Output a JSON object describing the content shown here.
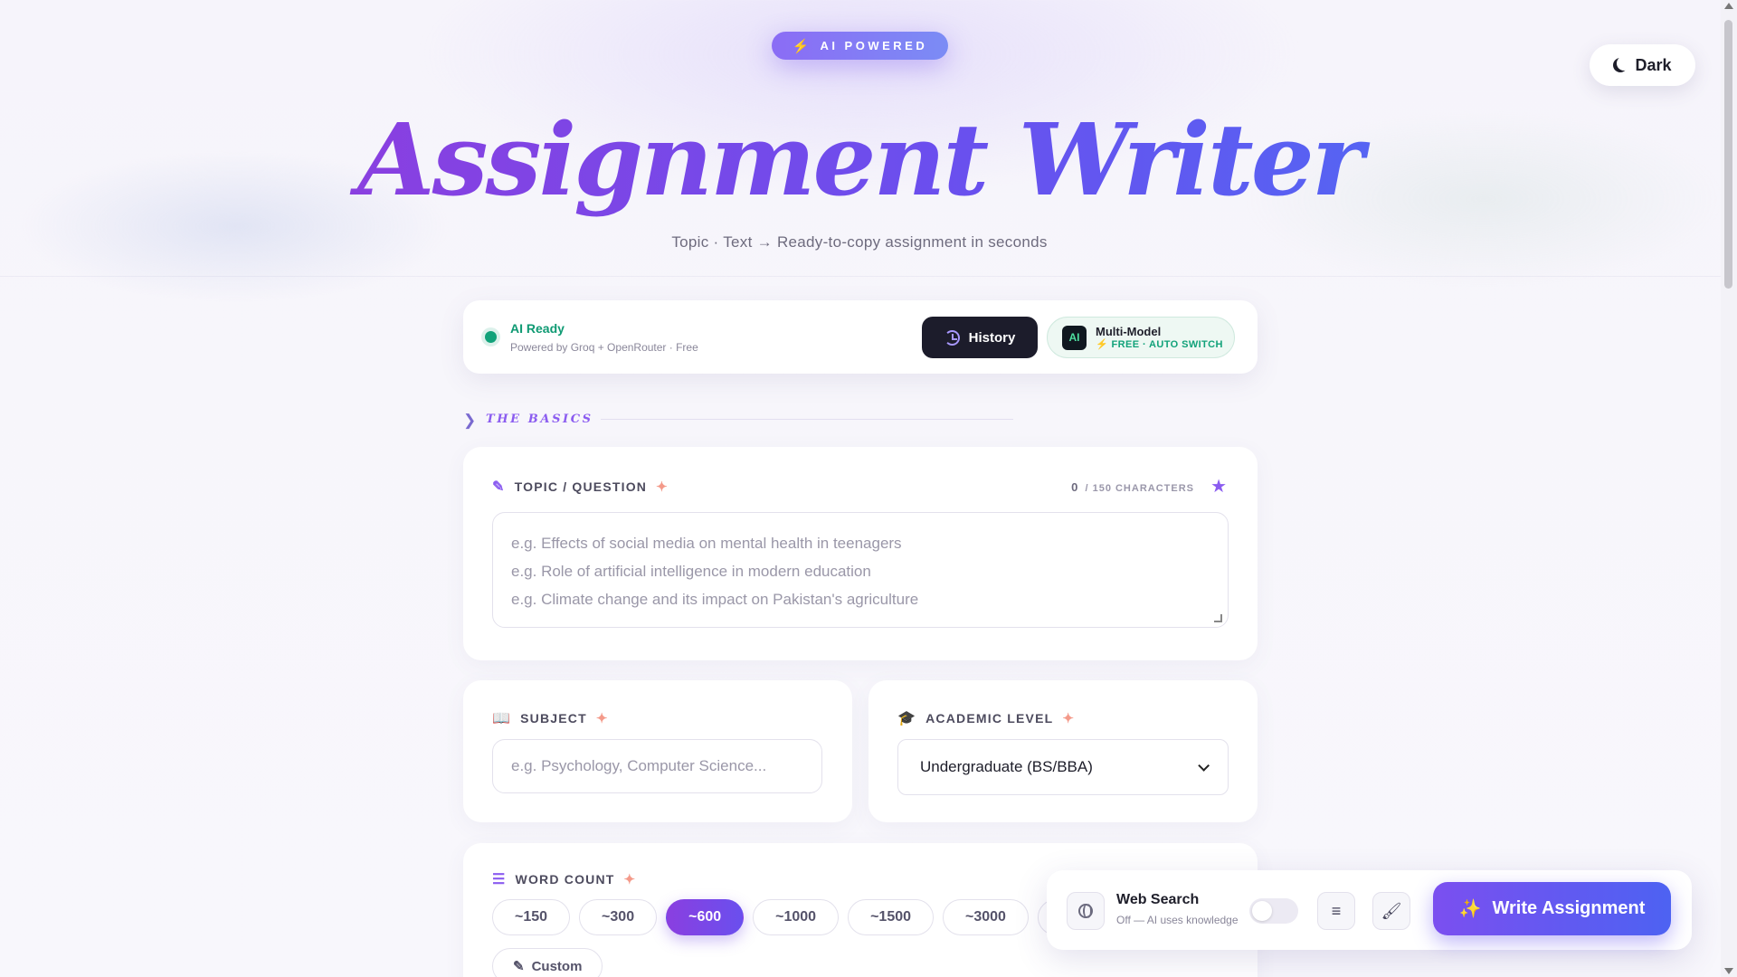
{
  "badge": {
    "icon": "bolt-icon",
    "label": "AI POWERED"
  },
  "theme_toggle": {
    "label": "Dark",
    "icon": "moon-icon"
  },
  "hero": {
    "title": "Assignment Writer",
    "subtitle": "Topic · Text → Ready-to-copy assignment in seconds"
  },
  "status": {
    "title": "AI Ready",
    "subtitle": "Powered by Groq + OpenRouter · Free",
    "history_label": "History",
    "model_badge": "AI",
    "model_title": "Multi-Model",
    "model_sub": "⚡ FREE · AUTO SWITCH"
  },
  "section": {
    "title": "THE BASICS"
  },
  "topic": {
    "label": "TOPIC / QUESTION",
    "count": "0",
    "count_suffix": "/ 150 CHARACTERS",
    "placeholder_lines": [
      "e.g. Effects of social media on mental health in teenagers",
      "e.g. Role of artificial intelligence in modern education",
      "e.g. Climate change and its impact on Pakistan's agriculture"
    ]
  },
  "subject": {
    "label": "SUBJECT",
    "placeholder": "e.g. Psychology, Computer Science..."
  },
  "level": {
    "label": "ACADEMIC LEVEL",
    "selected": "Undergraduate (BS/BBA)"
  },
  "word_count": {
    "label": "WORD COUNT",
    "options": [
      "~150",
      "~300",
      "~600",
      "~1000",
      "~1500",
      "~3000",
      "~"
    ],
    "selected": "~600",
    "custom_label": "Custom"
  },
  "action_bar": {
    "web_search_title": "Web Search",
    "web_search_sub": "Off — AI uses knowledge",
    "web_search_enabled": false,
    "write_label": "Write Assignment"
  },
  "colors": {
    "accent": "#8b5cf0",
    "accent2": "#4d62f2",
    "success": "#12a27a",
    "dark": "#1c1c2b"
  }
}
